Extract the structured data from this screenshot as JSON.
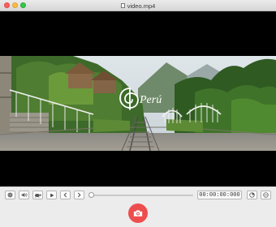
{
  "window": {
    "title": "video.mp4"
  },
  "video": {
    "logo_text": "Perú"
  },
  "controls": {
    "settings_icon": "gear-icon",
    "volume_icon": "volume-icon",
    "speed_icon": "turtle-icon",
    "play_icon": "play-icon",
    "prev_icon": "chevron-left-icon",
    "next_icon": "chevron-right-icon",
    "progress": 0,
    "timecode": "00:00:00:000",
    "extra_icon_1": "clock-icon",
    "extra_icon_2": "more-icon"
  },
  "snapshot": {
    "icon": "camera-icon",
    "color": "#ee4d4d"
  },
  "colors": {
    "close": "#fc605c",
    "minimize": "#fdbc40",
    "maximize": "#34c84a"
  }
}
